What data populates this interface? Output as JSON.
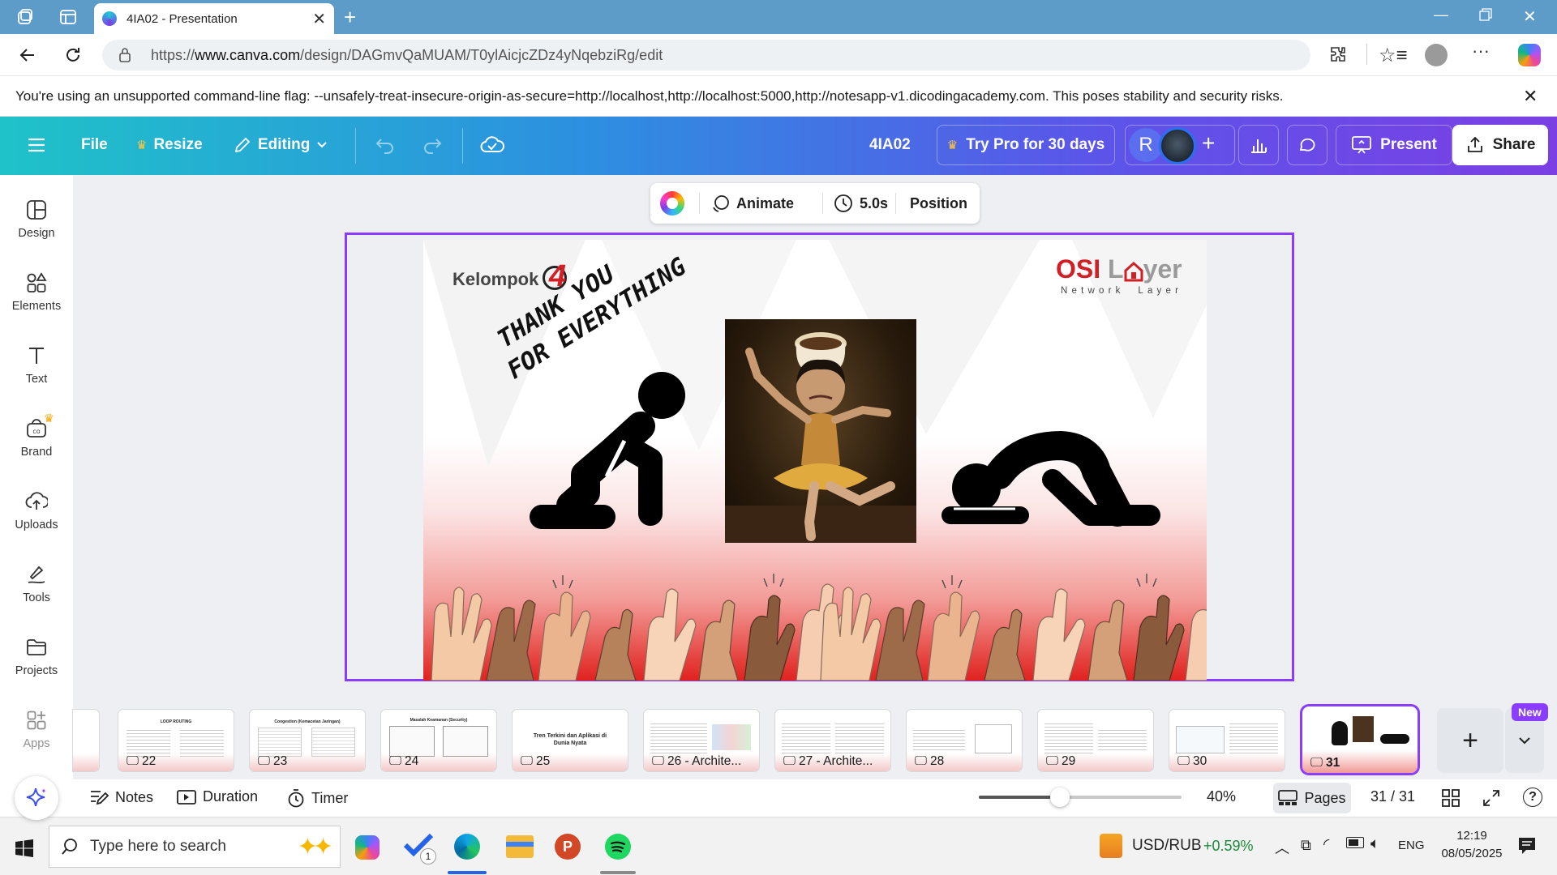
{
  "browser": {
    "tab_title": "4IA02 - Presentation",
    "url_prefix": "https://",
    "url_host": "www.canva.com",
    "url_path": "/design/DAGmvQaMUAM/T0ylAicjcZDz4yNqebziRg/edit"
  },
  "warning": {
    "text": "You're using an unsupported command-line flag: --unsafely-treat-insecure-origin-as-secure=http://localhost,http://localhost:5000,http://notesapp-v1.dicodingacademy.com. This poses stability and security risks."
  },
  "header": {
    "file": "File",
    "resize": "Resize",
    "editing": "Editing",
    "doc_title": "4IA02",
    "try_pro": "Try Pro for 30 days",
    "avatar_letter": "R",
    "present": "Present",
    "share": "Share"
  },
  "sidebar": {
    "items": [
      {
        "label": "Design",
        "icon": "design-icon"
      },
      {
        "label": "Elements",
        "icon": "elements-icon"
      },
      {
        "label": "Text",
        "icon": "text-icon"
      },
      {
        "label": "Brand",
        "icon": "brand-icon"
      },
      {
        "label": "Uploads",
        "icon": "uploads-icon"
      },
      {
        "label": "Tools",
        "icon": "tools-icon"
      },
      {
        "label": "Projects",
        "icon": "projects-icon"
      },
      {
        "label": "Apps",
        "icon": "apps-icon"
      }
    ]
  },
  "toolbar": {
    "animate": "Animate",
    "duration": "5.0s",
    "position": "Position"
  },
  "slide": {
    "group_text": "Kelompok",
    "group_number": "4",
    "logo_osi": "OSI",
    "logo_layer_l": "L",
    "logo_layer_rest": "yer",
    "logo_sub": "Network  Layer",
    "handwriting_line1": "THANK YOU",
    "handwriting_line2": "FOR EVERYTHING"
  },
  "pages": {
    "thumbs": [
      {
        "num": "22",
        "label": "22",
        "title": "LOOP ROUTING"
      },
      {
        "num": "23",
        "label": "23",
        "title": "Congestion (Kemacetan Jaringan)"
      },
      {
        "num": "24",
        "label": "24",
        "title": "Masalah Keamanan (Security)"
      },
      {
        "num": "25",
        "label": "25",
        "title": "Tren Terkini dan Aplikasi di Dunia Nyata"
      },
      {
        "num": "26",
        "label": "26 - Archite...",
        "title": ""
      },
      {
        "num": "27",
        "label": "27 - Archite...",
        "title": ""
      },
      {
        "num": "28",
        "label": "28",
        "title": ""
      },
      {
        "num": "29",
        "label": "29",
        "title": ""
      },
      {
        "num": "30",
        "label": "30",
        "title": ""
      },
      {
        "num": "31",
        "label": "31",
        "title": ""
      }
    ],
    "new_badge": "New"
  },
  "footer": {
    "notes": "Notes",
    "duration": "Duration",
    "timer": "Timer",
    "zoom": "40%",
    "zoom_fraction": 0.4,
    "pages": "Pages",
    "page_count": "31 / 31"
  },
  "taskbar": {
    "search_placeholder": "Type here to search",
    "ticker_name": "USD/RUB",
    "ticker_change": "+0.59%",
    "lang": "ENG",
    "time": "12:19",
    "date": "08/05/2025",
    "check_badge": "1"
  },
  "colors": {
    "accent": "#8b3dff",
    "header_start": "#1fc2c9",
    "header_end": "#7b3fe4",
    "logo_red": "#d11f26",
    "ticker_green": "#1a8a3a"
  }
}
